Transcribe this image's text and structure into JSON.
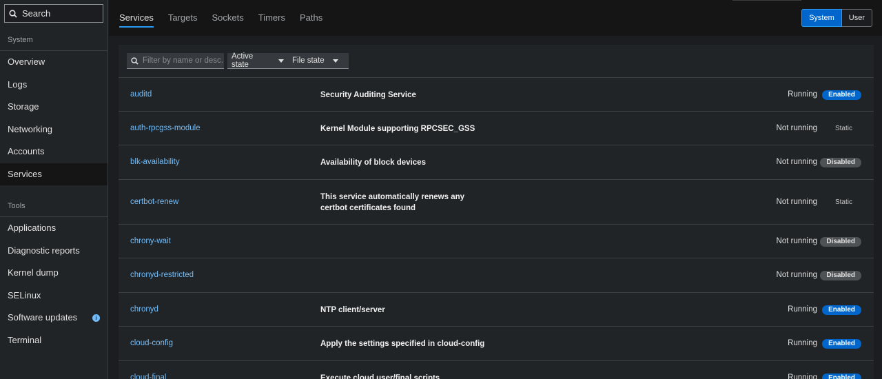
{
  "sidebar": {
    "search_label": "Search",
    "system_title": "System",
    "system_items": [
      {
        "label": "Overview"
      },
      {
        "label": "Logs"
      },
      {
        "label": "Storage"
      },
      {
        "label": "Networking"
      },
      {
        "label": "Accounts"
      },
      {
        "label": "Services",
        "active": true
      }
    ],
    "tools_title": "Tools",
    "tools_items": [
      {
        "label": "Applications"
      },
      {
        "label": "Diagnostic reports"
      },
      {
        "label": "Kernel dump"
      },
      {
        "label": "SELinux"
      },
      {
        "label": "Software updates",
        "badge": "i"
      },
      {
        "label": "Terminal"
      }
    ]
  },
  "header": {
    "tabs": [
      {
        "label": "Services",
        "active": true
      },
      {
        "label": "Targets"
      },
      {
        "label": "Sockets"
      },
      {
        "label": "Timers"
      },
      {
        "label": "Paths"
      }
    ],
    "toggle": {
      "system": "System",
      "user": "User",
      "selected": "System"
    }
  },
  "toolbar": {
    "filter_placeholder": "Filter by name or desc...",
    "active_state": "Active state",
    "file_state": "File state"
  },
  "services": [
    {
      "name": "auditd",
      "desc": "Security Auditing Service",
      "state": "Running",
      "file_state": "Enabled",
      "kind": "enabled"
    },
    {
      "name": "auth-rpcgss-module",
      "desc": "Kernel Module supporting RPCSEC_GSS",
      "state": "Not running",
      "file_state": "Static",
      "kind": "static"
    },
    {
      "name": "blk-availability",
      "desc": "Availability of block devices",
      "state": "Not running",
      "file_state": "Disabled",
      "kind": "disabled"
    },
    {
      "name": "certbot-renew",
      "desc": "This service automatically renews any certbot certificates found",
      "state": "Not running",
      "file_state": "Static",
      "kind": "static"
    },
    {
      "name": "chrony-wait",
      "desc": "",
      "state": "Not running",
      "file_state": "Disabled",
      "kind": "disabled"
    },
    {
      "name": "chronyd-restricted",
      "desc": "",
      "state": "Not running",
      "file_state": "Disabled",
      "kind": "disabled"
    },
    {
      "name": "chronyd",
      "desc": "NTP client/server",
      "state": "Running",
      "file_state": "Enabled",
      "kind": "enabled"
    },
    {
      "name": "cloud-config",
      "desc": "Apply the settings specified in cloud-config",
      "state": "Running",
      "file_state": "Enabled",
      "kind": "enabled"
    },
    {
      "name": "cloud-final",
      "desc": "Execute cloud user/final scripts",
      "state": "Running",
      "file_state": "Enabled",
      "kind": "enabled"
    }
  ],
  "colors": {
    "accent": "#0066cc",
    "link": "#73bcf7",
    "background": "#1b1d21",
    "surface": "#212427"
  }
}
